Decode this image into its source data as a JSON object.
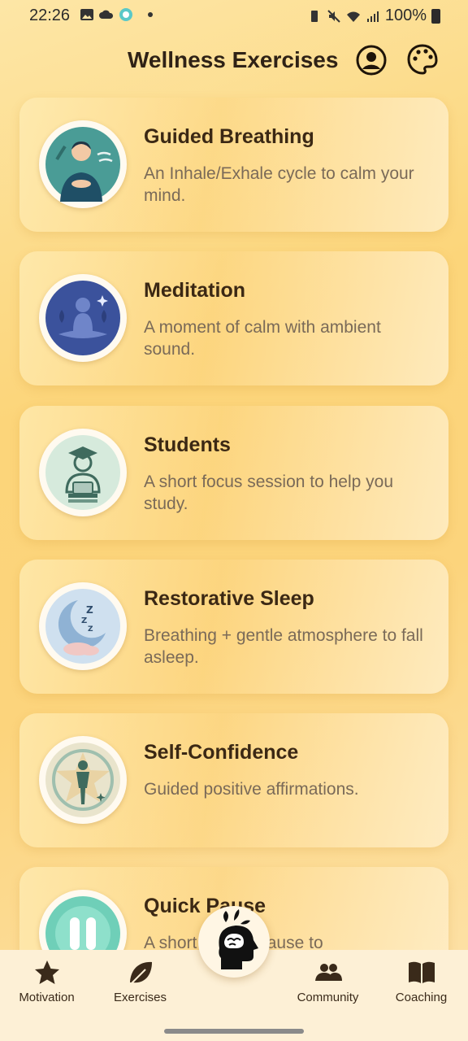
{
  "status_bar": {
    "time": "22:26",
    "battery": "100%"
  },
  "header": {
    "title": "Wellness Exercises"
  },
  "exercises": [
    {
      "title": "Guided Breathing",
      "description": "An Inhale/Exhale cycle to calm your mind.",
      "icon": "breathing-person-icon"
    },
    {
      "title": "Meditation",
      "description": "A moment of calm with ambient sound.",
      "icon": "meditation-icon"
    },
    {
      "title": "Students",
      "description": "A short focus session to help you study.",
      "icon": "student-icon"
    },
    {
      "title": "Restorative Sleep",
      "description": "Breathing + gentle atmosphere to fall asleep.",
      "icon": "moon-sleep-icon"
    },
    {
      "title": "Self-Confidence",
      "description": "Guided positive affirmations.",
      "icon": "confidence-star-icon"
    },
    {
      "title": "Quick Pause",
      "description": "A short minute pause to",
      "icon": "pause-icon"
    }
  ],
  "nav": {
    "motivation": "Motivation",
    "exercises": "Exercises",
    "community": "Community",
    "coaching": "Coaching"
  },
  "colors": {
    "accent_dark": "#2f2216",
    "description": "#7a6a58",
    "nav_bg": "#fdf0d6"
  }
}
